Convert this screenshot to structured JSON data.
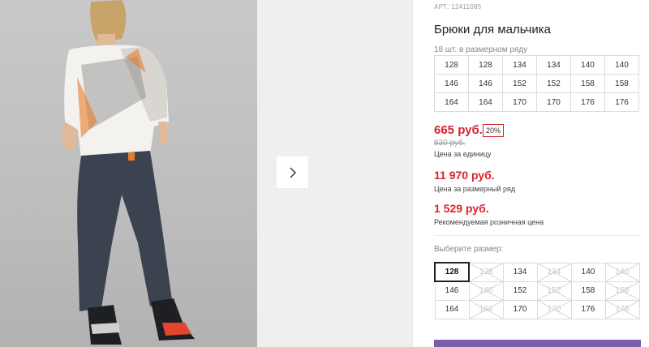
{
  "product": {
    "article": "АРТ: 12411085",
    "title": "Брюки для мальчика",
    "pack_note": "18 шт. в размерном ряду",
    "pack_sizes": [
      [
        "128",
        "128",
        "134",
        "134",
        "140",
        "140"
      ],
      [
        "146",
        "146",
        "152",
        "152",
        "158",
        "158"
      ],
      [
        "164",
        "164",
        "170",
        "170",
        "176",
        "176"
      ]
    ]
  },
  "pricing": {
    "unit_price": "665 руб.",
    "discount": "20%",
    "old_price": "830 руб.",
    "unit_label": "Цена за единицу",
    "set_price": "11 970 руб.",
    "set_label": "Цена за размерный ряд",
    "rrp_price": "1 529 руб.",
    "rrp_label": "Рекомендуемая розничная цена"
  },
  "size_selector": {
    "label": "Выберите размер:",
    "rows": [
      [
        {
          "v": "128",
          "state": "selected"
        },
        {
          "v": "128",
          "state": "disabled"
        },
        {
          "v": "134",
          "state": "available"
        },
        {
          "v": "134",
          "state": "disabled"
        },
        {
          "v": "140",
          "state": "available"
        },
        {
          "v": "140",
          "state": "disabled"
        }
      ],
      [
        {
          "v": "146",
          "state": "available"
        },
        {
          "v": "146",
          "state": "disabled"
        },
        {
          "v": "152",
          "state": "available"
        },
        {
          "v": "152",
          "state": "disabled"
        },
        {
          "v": "158",
          "state": "available"
        },
        {
          "v": "158",
          "state": "disabled"
        }
      ],
      [
        {
          "v": "164",
          "state": "available"
        },
        {
          "v": "164",
          "state": "disabled"
        },
        {
          "v": "170",
          "state": "available"
        },
        {
          "v": "170",
          "state": "disabled"
        },
        {
          "v": "176",
          "state": "available"
        },
        {
          "v": "176",
          "state": "disabled"
        }
      ]
    ]
  },
  "gallery": {
    "next_icon": "chevron-right-icon"
  },
  "colors": {
    "price_red": "#d9232f",
    "cart_purple": "#7b5ea7"
  }
}
